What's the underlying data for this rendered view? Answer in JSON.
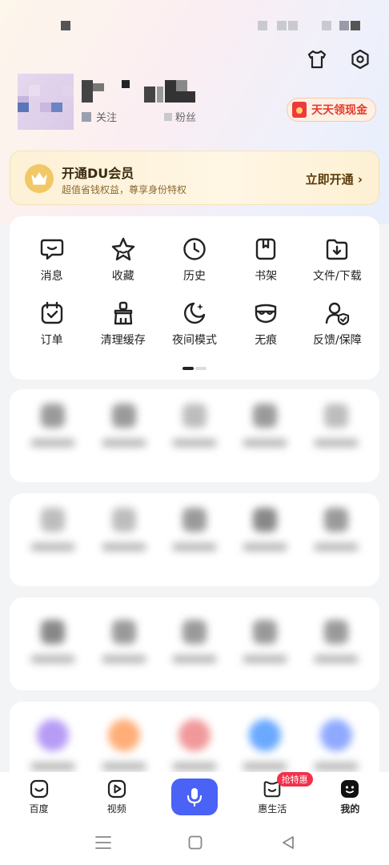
{
  "header": {
    "follow_label": "关注",
    "fans_label": "粉丝"
  },
  "cash_button": {
    "label": "天天领现金"
  },
  "vip": {
    "title": "开通DU会员",
    "subtitle": "超值省钱权益，尊享身份特权",
    "action": "立即开通 ›"
  },
  "tools": [
    {
      "label": "消息",
      "icon": "message-icon"
    },
    {
      "label": "收藏",
      "icon": "star-icon"
    },
    {
      "label": "历史",
      "icon": "clock-icon"
    },
    {
      "label": "书架",
      "icon": "bookshelf-icon"
    },
    {
      "label": "文件/下载",
      "icon": "download-folder-icon"
    },
    {
      "label": "订单",
      "icon": "order-icon"
    },
    {
      "label": "清理缓存",
      "icon": "broom-icon"
    },
    {
      "label": "夜间模式",
      "icon": "moon-icon"
    },
    {
      "label": "无痕",
      "icon": "mask-icon"
    },
    {
      "label": "反馈/保障",
      "icon": "feedback-shield-icon"
    }
  ],
  "bottom_nav": [
    {
      "label": "百度",
      "icon": "baidu-home-icon"
    },
    {
      "label": "视频",
      "icon": "video-icon"
    },
    {
      "label": "",
      "icon": "microphone-icon"
    },
    {
      "label": "惠生活",
      "icon": "life-icon",
      "badge": "抢特惠"
    },
    {
      "label": "我的",
      "icon": "profile-icon"
    }
  ],
  "colors": {
    "accent": "#4a62f5",
    "badge": "#f2304a",
    "cash_text": "#e23c2d",
    "vip_text": "#5b3b0a"
  }
}
